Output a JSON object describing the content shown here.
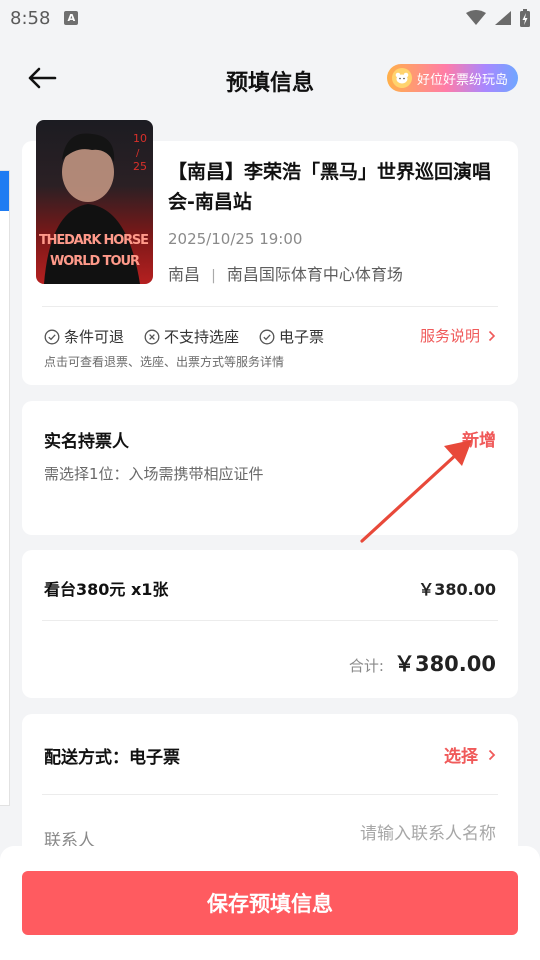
{
  "status_bar": {
    "time": "8:58",
    "notification_icon": "A"
  },
  "nav": {
    "title": "预填信息",
    "badge_label": "好位好票纷玩岛"
  },
  "event": {
    "title": "【南昌】李荣浩「黑马」世界巡回演唱会-南昌站",
    "datetime": "2025/10/25 19:00",
    "city": "南昌",
    "venue": "南昌国际体育中心体育场",
    "poster": {
      "date_top": "10",
      "date_slash": "/",
      "date_bottom": "25",
      "line1": "THEDARK HORSE",
      "line2": "WORLD TOUR"
    }
  },
  "services": {
    "items": [
      "条件可退",
      "不支持选座",
      "电子票"
    ],
    "link_label": "服务说明",
    "hint": "点击可查看退票、选座、出票方式等服务详情"
  },
  "holder": {
    "title": "实名持票人",
    "add_label": "新增",
    "hint": "需选择1位：入场需携带相应证件"
  },
  "price": {
    "label": "看台380元 x1张",
    "value": "￥380.00",
    "total_label": "合计:",
    "total_value": "￥380.00"
  },
  "delivery": {
    "label": "配送方式：电子票",
    "select_label": "选择",
    "contact_label": "联系人",
    "contact_placeholder": "请输入联系人名称"
  },
  "footer": {
    "save_label": "保存预填信息"
  },
  "colors": {
    "accent": "#f05a5a",
    "button": "#ff5b60",
    "arrow": "#e8493a"
  }
}
